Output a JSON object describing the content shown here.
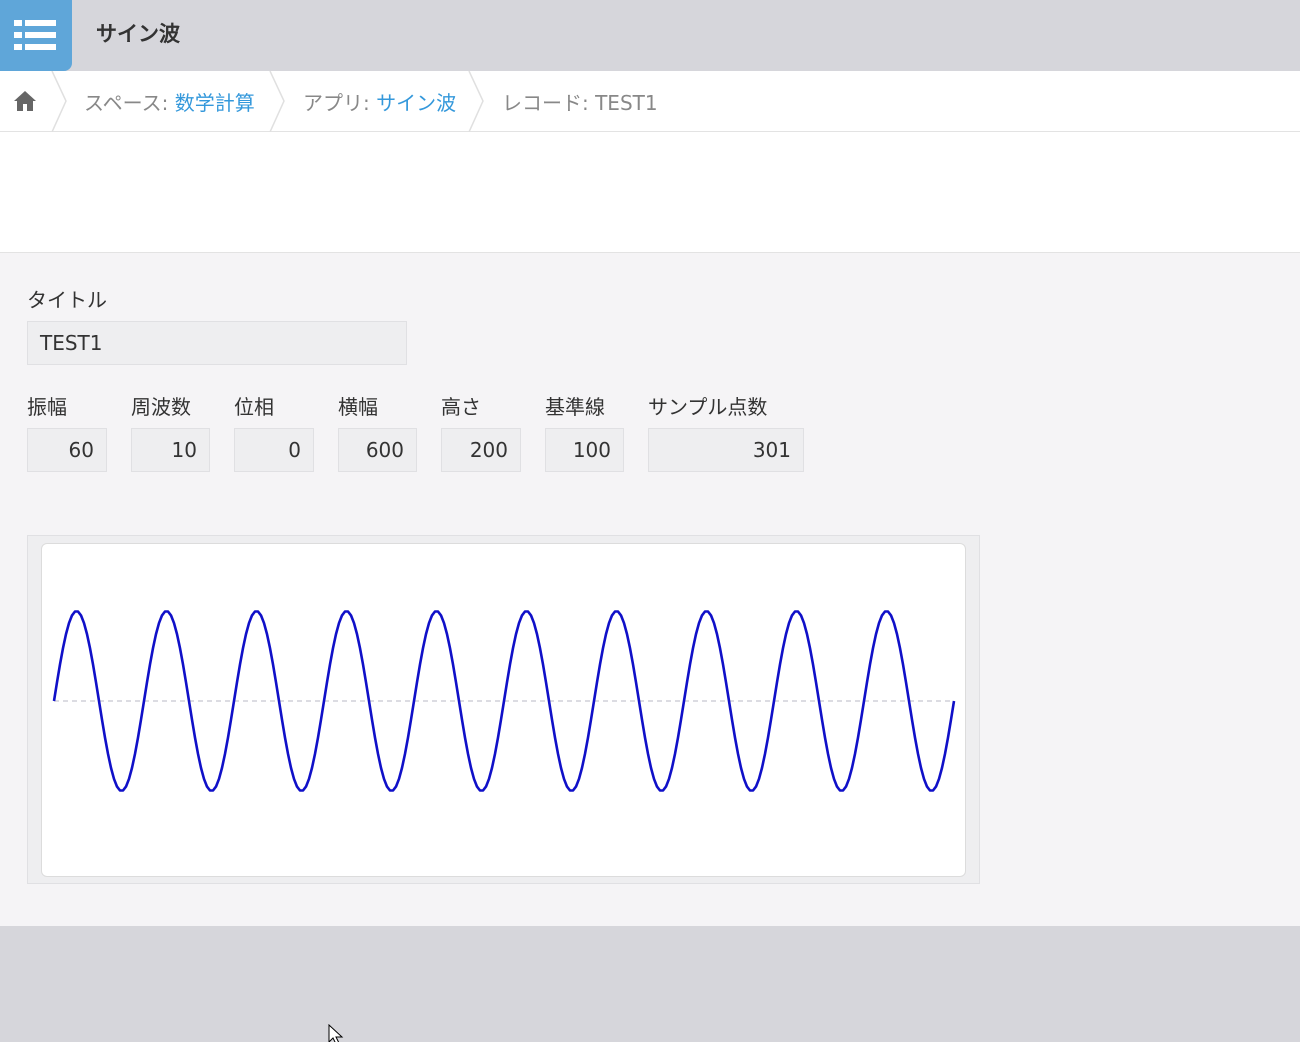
{
  "app": {
    "title": "サイン波",
    "icon": "app-list-icon"
  },
  "breadcrumb": {
    "home_icon": "home-icon",
    "space_prefix": "スペース: ",
    "space_name": "数学計算",
    "app_prefix": "アプリ: ",
    "app_name": "サイン波",
    "record_label": "レコード: TEST1"
  },
  "record": {
    "title_label": "タイトル",
    "title_value": "TEST1",
    "fields": [
      {
        "label": "振幅",
        "value": "60"
      },
      {
        "label": "周波数",
        "value": "10"
      },
      {
        "label": "位相",
        "value": "0"
      },
      {
        "label": "横幅",
        "value": "600"
      },
      {
        "label": "高さ",
        "value": "200"
      },
      {
        "label": "基準線",
        "value": "100"
      },
      {
        "label": "サンプル点数",
        "value": "301"
      }
    ]
  },
  "chart_data": {
    "type": "line",
    "function": "sine",
    "amplitude": 60,
    "frequency": 10,
    "phase": 0,
    "width": 600,
    "height": 200,
    "baseline": 100,
    "samples": 301,
    "line_color": "#1010c8",
    "baseline_color": "#c8c8d0",
    "baseline_style": "dashed"
  },
  "colors": {
    "header_bg": "#d6d6db",
    "app_icon_bg": "#5fa6d9",
    "link": "#3498db",
    "record_bg": "#f5f4f6"
  }
}
